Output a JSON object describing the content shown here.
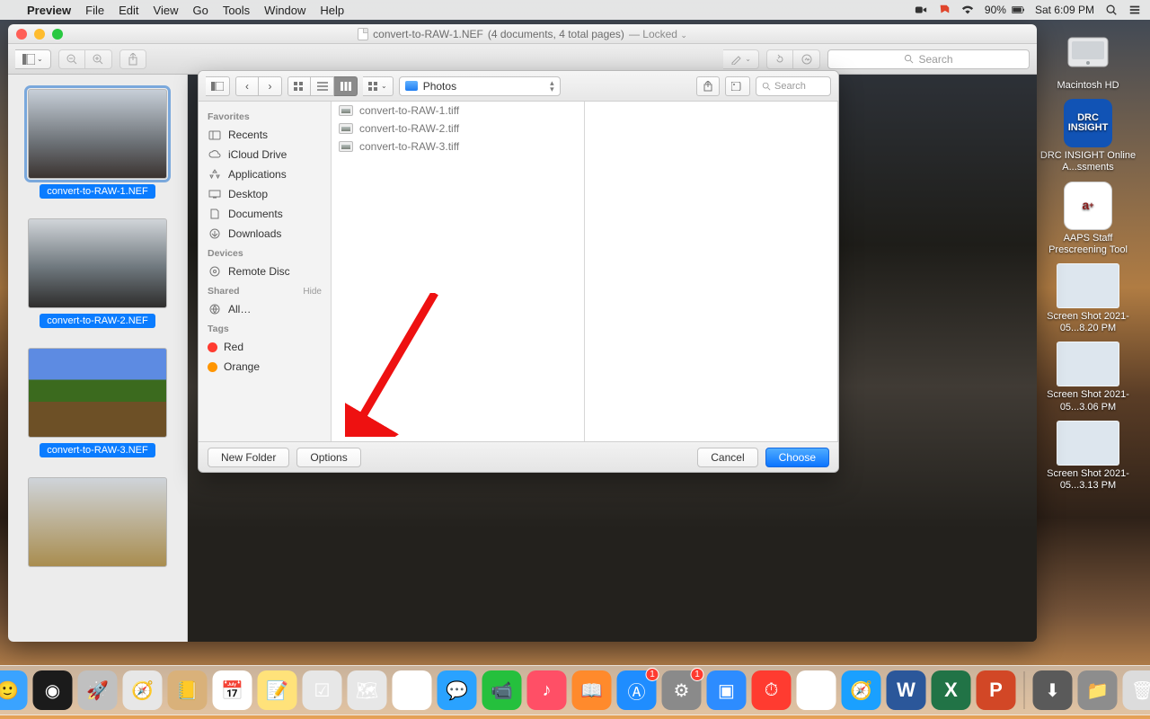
{
  "menubar": {
    "app": "Preview",
    "items": [
      "File",
      "Edit",
      "View",
      "Go",
      "Tools",
      "Window",
      "Help"
    ],
    "status": {
      "wifi": "90%",
      "clock": "Sat 6:09 PM"
    }
  },
  "window": {
    "title_file": "convert-to-RAW-1.NEF",
    "title_meta": "(4 documents, 4 total pages)",
    "title_state": "— Locked",
    "toolbar_search_placeholder": "Search"
  },
  "preview_sidebar": {
    "items": [
      {
        "label": "convert-to-RAW-1.NEF",
        "selected": true
      },
      {
        "label": "convert-to-RAW-2.NEF",
        "selected": false
      },
      {
        "label": "convert-to-RAW-3.NEF",
        "selected": false
      }
    ]
  },
  "sheet": {
    "folder": "Photos",
    "search_placeholder": "Search",
    "favorites_header": "Favorites",
    "favorites": [
      "Recents",
      "iCloud Drive",
      "Applications",
      "Desktop",
      "Documents",
      "Downloads"
    ],
    "devices_header": "Devices",
    "devices": [
      "Remote Disc"
    ],
    "shared_header": "Shared",
    "shared_hide": "Hide",
    "shared": [
      "All…"
    ],
    "tags_header": "Tags",
    "tags": [
      {
        "name": "Red",
        "color": "#ff3b30"
      },
      {
        "name": "Orange",
        "color": "#ff9500"
      }
    ],
    "column_files": [
      "convert-to-RAW-1.tiff",
      "convert-to-RAW-2.tiff",
      "convert-to-RAW-3.tiff"
    ],
    "buttons": {
      "new_folder": "New Folder",
      "options": "Options",
      "cancel": "Cancel",
      "choose": "Choose"
    }
  },
  "desktop_icons": {
    "hd": "Macintosh HD",
    "drc": "DRC INSIGHT Online A...ssments",
    "aaps": "AAPS Staff Prescreening Tool",
    "shots": [
      "Screen Shot 2021-05...8.20 PM",
      "Screen Shot 2021-05...3.06 PM",
      "Screen Shot 2021-05...3.13 PM"
    ]
  },
  "dock": {
    "items": [
      {
        "name": "finder",
        "badge": null,
        "color": "#3aa3ff"
      },
      {
        "name": "siri",
        "badge": null,
        "color": "#1b1b1b"
      },
      {
        "name": "launchpad",
        "badge": null,
        "color": "#c0c0c0"
      },
      {
        "name": "safari",
        "badge": null,
        "color": "#e7e7e7"
      },
      {
        "name": "contacts",
        "badge": null,
        "color": "#d9b17a"
      },
      {
        "name": "calendar",
        "badge": null,
        "color": "#ffffff"
      },
      {
        "name": "notes",
        "badge": null,
        "color": "#ffe27a"
      },
      {
        "name": "reminders",
        "badge": null,
        "color": "#e7e7e7"
      },
      {
        "name": "maps",
        "badge": null,
        "color": "#e7e7e7"
      },
      {
        "name": "photos",
        "badge": null,
        "color": "#ffffff"
      },
      {
        "name": "messages",
        "badge": null,
        "color": "#2aa2ff"
      },
      {
        "name": "facetime",
        "badge": null,
        "color": "#25c03d"
      },
      {
        "name": "itunes",
        "badge": null,
        "color": "#ff4f66"
      },
      {
        "name": "ibooks",
        "badge": null,
        "color": "#ff8a2c"
      },
      {
        "name": "appstore",
        "badge": "1",
        "color": "#1f8dff"
      },
      {
        "name": "preferences",
        "badge": "1",
        "color": "#8a8a8a"
      },
      {
        "name": "zoom",
        "badge": null,
        "color": "#2d8cff"
      },
      {
        "name": "clock",
        "badge": null,
        "color": "#ff3b30"
      },
      {
        "name": "chrome",
        "badge": null,
        "color": "#ffffff"
      },
      {
        "name": "safari-compass",
        "badge": null,
        "color": "#1aa0ff"
      },
      {
        "name": "word",
        "badge": null,
        "color": "#2b579a"
      },
      {
        "name": "excel",
        "badge": null,
        "color": "#217346"
      },
      {
        "name": "powerpoint",
        "badge": null,
        "color": "#d24726"
      }
    ],
    "right": [
      {
        "name": "downloads",
        "color": "#5a5a5a"
      },
      {
        "name": "folder",
        "color": "#8d8d8d"
      },
      {
        "name": "trash",
        "color": "#dcdcdc"
      }
    ]
  }
}
